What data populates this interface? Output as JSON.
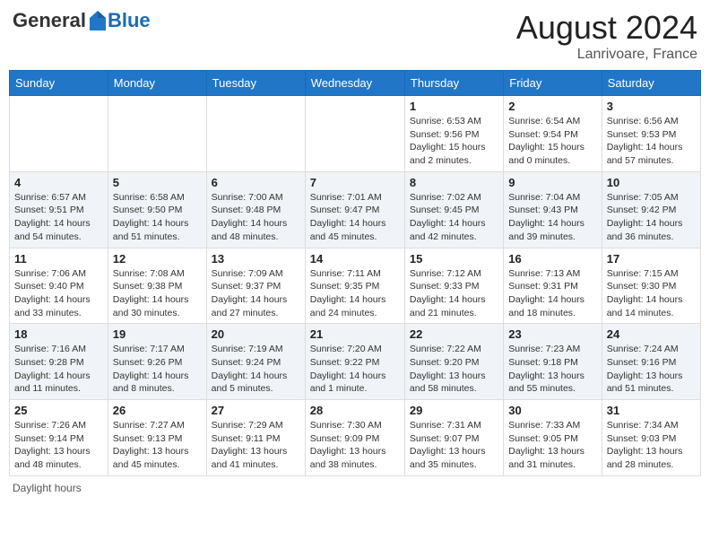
{
  "header": {
    "logo_general": "General",
    "logo_blue": "Blue",
    "month_year": "August 2024",
    "location": "Lanrivoare, France"
  },
  "days_of_week": [
    "Sunday",
    "Monday",
    "Tuesday",
    "Wednesday",
    "Thursday",
    "Friday",
    "Saturday"
  ],
  "footer": {
    "daylight_hours": "Daylight hours"
  },
  "weeks": [
    [
      {
        "num": "",
        "sunrise": "",
        "sunset": "",
        "daylight": ""
      },
      {
        "num": "",
        "sunrise": "",
        "sunset": "",
        "daylight": ""
      },
      {
        "num": "",
        "sunrise": "",
        "sunset": "",
        "daylight": ""
      },
      {
        "num": "",
        "sunrise": "",
        "sunset": "",
        "daylight": ""
      },
      {
        "num": "1",
        "sunrise": "Sunrise: 6:53 AM",
        "sunset": "Sunset: 9:56 PM",
        "daylight": "Daylight: 15 hours and 2 minutes."
      },
      {
        "num": "2",
        "sunrise": "Sunrise: 6:54 AM",
        "sunset": "Sunset: 9:54 PM",
        "daylight": "Daylight: 15 hours and 0 minutes."
      },
      {
        "num": "3",
        "sunrise": "Sunrise: 6:56 AM",
        "sunset": "Sunset: 9:53 PM",
        "daylight": "Daylight: 14 hours and 57 minutes."
      }
    ],
    [
      {
        "num": "4",
        "sunrise": "Sunrise: 6:57 AM",
        "sunset": "Sunset: 9:51 PM",
        "daylight": "Daylight: 14 hours and 54 minutes."
      },
      {
        "num": "5",
        "sunrise": "Sunrise: 6:58 AM",
        "sunset": "Sunset: 9:50 PM",
        "daylight": "Daylight: 14 hours and 51 minutes."
      },
      {
        "num": "6",
        "sunrise": "Sunrise: 7:00 AM",
        "sunset": "Sunset: 9:48 PM",
        "daylight": "Daylight: 14 hours and 48 minutes."
      },
      {
        "num": "7",
        "sunrise": "Sunrise: 7:01 AM",
        "sunset": "Sunset: 9:47 PM",
        "daylight": "Daylight: 14 hours and 45 minutes."
      },
      {
        "num": "8",
        "sunrise": "Sunrise: 7:02 AM",
        "sunset": "Sunset: 9:45 PM",
        "daylight": "Daylight: 14 hours and 42 minutes."
      },
      {
        "num": "9",
        "sunrise": "Sunrise: 7:04 AM",
        "sunset": "Sunset: 9:43 PM",
        "daylight": "Daylight: 14 hours and 39 minutes."
      },
      {
        "num": "10",
        "sunrise": "Sunrise: 7:05 AM",
        "sunset": "Sunset: 9:42 PM",
        "daylight": "Daylight: 14 hours and 36 minutes."
      }
    ],
    [
      {
        "num": "11",
        "sunrise": "Sunrise: 7:06 AM",
        "sunset": "Sunset: 9:40 PM",
        "daylight": "Daylight: 14 hours and 33 minutes."
      },
      {
        "num": "12",
        "sunrise": "Sunrise: 7:08 AM",
        "sunset": "Sunset: 9:38 PM",
        "daylight": "Daylight: 14 hours and 30 minutes."
      },
      {
        "num": "13",
        "sunrise": "Sunrise: 7:09 AM",
        "sunset": "Sunset: 9:37 PM",
        "daylight": "Daylight: 14 hours and 27 minutes."
      },
      {
        "num": "14",
        "sunrise": "Sunrise: 7:11 AM",
        "sunset": "Sunset: 9:35 PM",
        "daylight": "Daylight: 14 hours and 24 minutes."
      },
      {
        "num": "15",
        "sunrise": "Sunrise: 7:12 AM",
        "sunset": "Sunset: 9:33 PM",
        "daylight": "Daylight: 14 hours and 21 minutes."
      },
      {
        "num": "16",
        "sunrise": "Sunrise: 7:13 AM",
        "sunset": "Sunset: 9:31 PM",
        "daylight": "Daylight: 14 hours and 18 minutes."
      },
      {
        "num": "17",
        "sunrise": "Sunrise: 7:15 AM",
        "sunset": "Sunset: 9:30 PM",
        "daylight": "Daylight: 14 hours and 14 minutes."
      }
    ],
    [
      {
        "num": "18",
        "sunrise": "Sunrise: 7:16 AM",
        "sunset": "Sunset: 9:28 PM",
        "daylight": "Daylight: 14 hours and 11 minutes."
      },
      {
        "num": "19",
        "sunrise": "Sunrise: 7:17 AM",
        "sunset": "Sunset: 9:26 PM",
        "daylight": "Daylight: 14 hours and 8 minutes."
      },
      {
        "num": "20",
        "sunrise": "Sunrise: 7:19 AM",
        "sunset": "Sunset: 9:24 PM",
        "daylight": "Daylight: 14 hours and 5 minutes."
      },
      {
        "num": "21",
        "sunrise": "Sunrise: 7:20 AM",
        "sunset": "Sunset: 9:22 PM",
        "daylight": "Daylight: 14 hours and 1 minute."
      },
      {
        "num": "22",
        "sunrise": "Sunrise: 7:22 AM",
        "sunset": "Sunset: 9:20 PM",
        "daylight": "Daylight: 13 hours and 58 minutes."
      },
      {
        "num": "23",
        "sunrise": "Sunrise: 7:23 AM",
        "sunset": "Sunset: 9:18 PM",
        "daylight": "Daylight: 13 hours and 55 minutes."
      },
      {
        "num": "24",
        "sunrise": "Sunrise: 7:24 AM",
        "sunset": "Sunset: 9:16 PM",
        "daylight": "Daylight: 13 hours and 51 minutes."
      }
    ],
    [
      {
        "num": "25",
        "sunrise": "Sunrise: 7:26 AM",
        "sunset": "Sunset: 9:14 PM",
        "daylight": "Daylight: 13 hours and 48 minutes."
      },
      {
        "num": "26",
        "sunrise": "Sunrise: 7:27 AM",
        "sunset": "Sunset: 9:13 PM",
        "daylight": "Daylight: 13 hours and 45 minutes."
      },
      {
        "num": "27",
        "sunrise": "Sunrise: 7:29 AM",
        "sunset": "Sunset: 9:11 PM",
        "daylight": "Daylight: 13 hours and 41 minutes."
      },
      {
        "num": "28",
        "sunrise": "Sunrise: 7:30 AM",
        "sunset": "Sunset: 9:09 PM",
        "daylight": "Daylight: 13 hours and 38 minutes."
      },
      {
        "num": "29",
        "sunrise": "Sunrise: 7:31 AM",
        "sunset": "Sunset: 9:07 PM",
        "daylight": "Daylight: 13 hours and 35 minutes."
      },
      {
        "num": "30",
        "sunrise": "Sunrise: 7:33 AM",
        "sunset": "Sunset: 9:05 PM",
        "daylight": "Daylight: 13 hours and 31 minutes."
      },
      {
        "num": "31",
        "sunrise": "Sunrise: 7:34 AM",
        "sunset": "Sunset: 9:03 PM",
        "daylight": "Daylight: 13 hours and 28 minutes."
      }
    ]
  ]
}
